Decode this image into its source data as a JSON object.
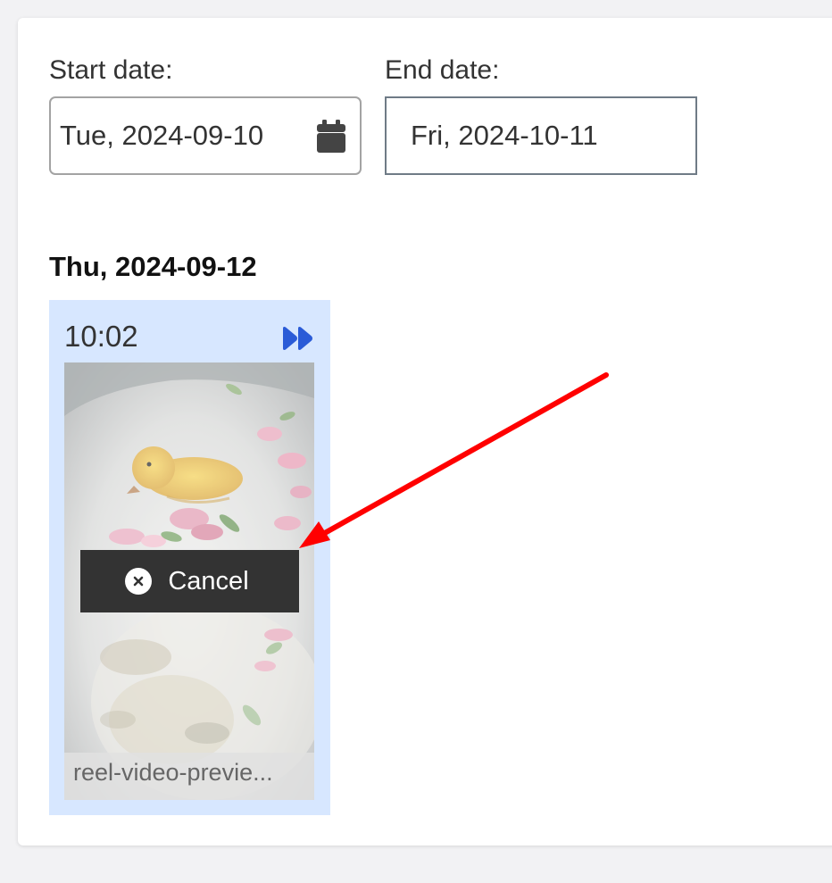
{
  "filters": {
    "start_label": "Start date:",
    "start_value": "Tue, 2024-09-10",
    "end_label": "End date:",
    "end_value": "Fri, 2024-10-11"
  },
  "day_group": {
    "heading": "Thu, 2024-09-12"
  },
  "card": {
    "time": "10:02",
    "file_name": "reel-video-previe...",
    "cancel_label": "Cancel"
  },
  "icons": {
    "calendar": "calendar-icon",
    "forward": "fast-forward-icon",
    "cancel": "close-circle-icon"
  },
  "colors": {
    "card_background": "#d7e7ff",
    "forward_icon": "#2a5bd7",
    "cancel_button": "#333333",
    "annotation_arrow": "#ff0000"
  }
}
